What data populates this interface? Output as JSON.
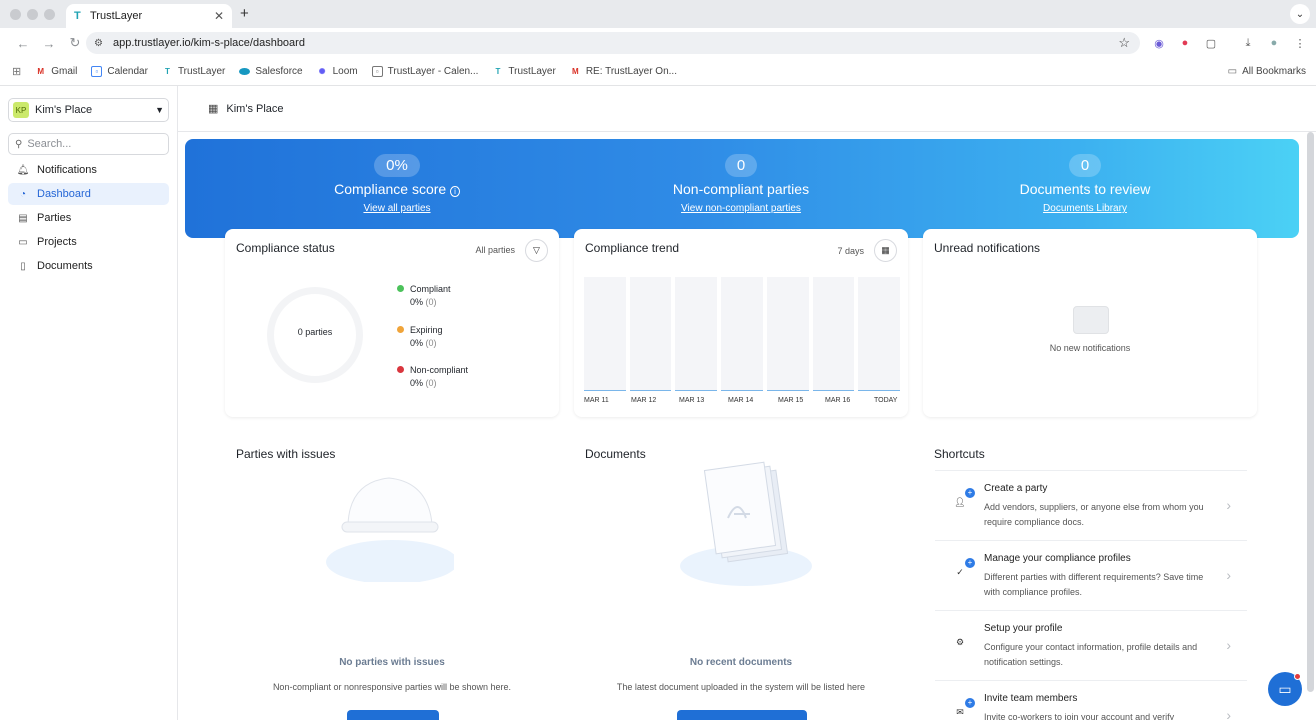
{
  "browser": {
    "tab_title": "TrustLayer",
    "tab_favicon": "T",
    "new_tab": "+",
    "url": "app.trustlayer.io/kim-s-place/dashboard",
    "bookmarks": [
      "Gmail",
      "Calendar",
      "TrustLayer",
      "Salesforce",
      "Loom",
      "TrustLayer - Calen...",
      "TrustLayer",
      "RE: TrustLayer On..."
    ],
    "all_bookmarks": "All Bookmarks"
  },
  "sidebar": {
    "org_initials": "KP",
    "org_name": "Kim's Place",
    "search_placeholder": "Search...",
    "items": [
      {
        "label": "Notifications",
        "icon": "bell-icon"
      },
      {
        "label": "Dashboard",
        "icon": "dashboard-icon"
      },
      {
        "label": "Parties",
        "icon": "parties-icon"
      },
      {
        "label": "Projects",
        "icon": "folder-icon"
      },
      {
        "label": "Documents",
        "icon": "document-icon"
      }
    ],
    "active": "Dashboard"
  },
  "header": {
    "title": "Kim's Place"
  },
  "hero": {
    "compliance_score": "0%",
    "compliance_label": "Compliance score",
    "compliance_info": "i",
    "compliance_link": "View all parties",
    "noncompliant_value": "0",
    "noncompliant_label": "Non-compliant parties",
    "noncompliant_link": "View non-compliant parties",
    "docs_value": "0",
    "docs_label": "Documents to review",
    "docs_link": "Documents Library"
  },
  "compliance_status": {
    "title": "Compliance status",
    "filter_label": "All parties",
    "center_label": "0 parties",
    "legend": [
      {
        "name": "Compliant",
        "pct": "0%",
        "count": "(0)",
        "color": "#4cc25b"
      },
      {
        "name": "Expiring",
        "pct": "0%",
        "count": "(0)",
        "color": "#f0a43a"
      },
      {
        "name": "Non-compliant",
        "pct": "0%",
        "count": "(0)",
        "color": "#d9363e"
      }
    ]
  },
  "compliance_trend": {
    "title": "Compliance trend",
    "range_label": "7 days",
    "x_labels": [
      "MAR 11",
      "MAR 12",
      "MAR 13",
      "MAR 14",
      "MAR 15",
      "MAR 16",
      "TODAY"
    ]
  },
  "notifications": {
    "title": "Unread notifications",
    "empty": "No new notifications"
  },
  "parties_issues": {
    "title": "Parties with issues",
    "empty_title": "No parties with issues",
    "empty_sub": "Non-compliant or nonresponsive parties will be shown here."
  },
  "documents": {
    "title": "Documents",
    "empty_title": "No recent documents",
    "empty_sub": "The latest document uploaded in the system will be listed here"
  },
  "shortcuts": {
    "title": "Shortcuts",
    "items": [
      {
        "title": "Create a party",
        "desc": "Add vendors, suppliers, or anyone else from whom you require compliance docs.",
        "icon": "add-person-icon"
      },
      {
        "title": "Manage your compliance profiles",
        "desc": "Different parties with different requirements? Save time with compliance profiles.",
        "icon": "add-check-icon"
      },
      {
        "title": "Setup your profile",
        "desc": "Configure your contact information, profile details and notification settings.",
        "icon": "settings-icon"
      },
      {
        "title": "Invite team members",
        "desc": "Invite co-workers to join your account and verify",
        "icon": "invite-icon"
      }
    ]
  }
}
